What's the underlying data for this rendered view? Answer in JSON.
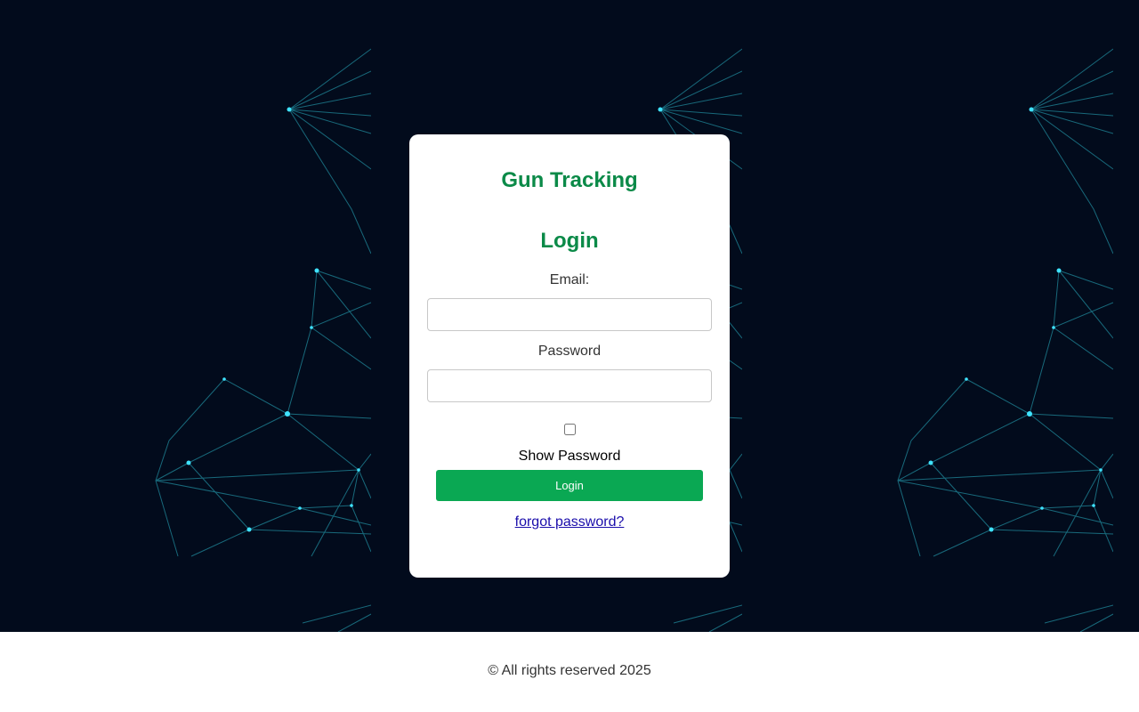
{
  "app": {
    "title": "Gun Tracking"
  },
  "login_form": {
    "heading": "Login",
    "email_label": "Email:",
    "email_value": "",
    "password_label": "Password",
    "password_value": "",
    "show_password_label": "Show Password",
    "show_password_checked": false,
    "submit_label": "Login",
    "forgot_link": "forgot password?"
  },
  "footer": {
    "text": "© All rights reserved 2025"
  },
  "colors": {
    "background": "#020b1c",
    "accent_green": "#0aa853",
    "title_green": "#0b8a48",
    "link_blue": "#1a0dab",
    "network_lines": "#2fd0e6"
  }
}
